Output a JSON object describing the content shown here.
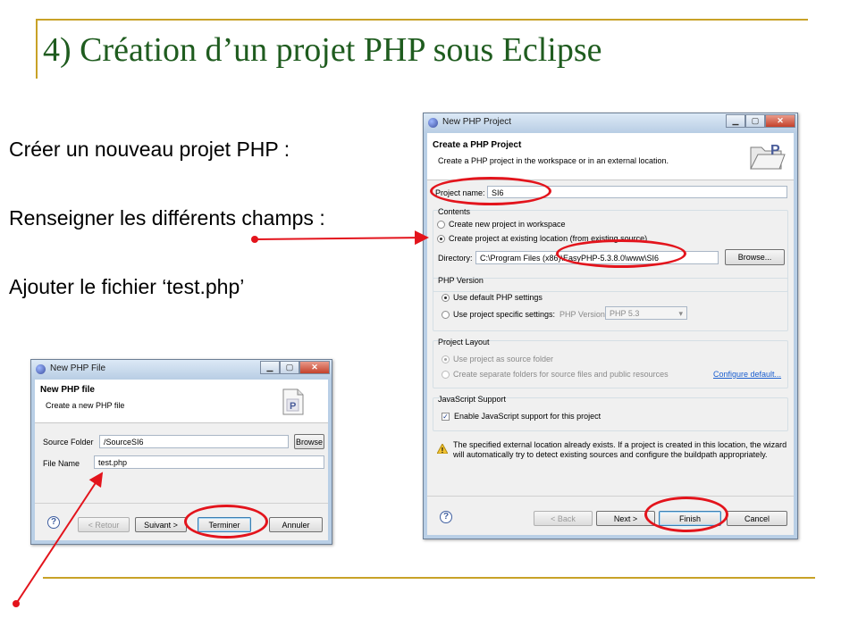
{
  "slide": {
    "title": "4) Création d’un projet PHP sous Eclipse",
    "bullets": [
      "Créer un nouveau projet PHP :",
      "Renseigner les différents champs :",
      "Ajouter le fichier ‘test.php’"
    ]
  },
  "colors": {
    "accent_rule": "#c8a227",
    "title": "#1f5c1f",
    "annotation": "#e3141c"
  },
  "php_file_dialog": {
    "window_title": "New PHP File",
    "header": "New PHP file",
    "description": "Create a new PHP file",
    "source_folder_label": "Source Folder",
    "source_folder_value": "/SourceSI6",
    "browse_label": "Browse",
    "file_name_label": "File Name",
    "file_name_value": "test.php",
    "back_label": "< Retour",
    "next_label": "Suivant >",
    "finish_label": "Terminer",
    "cancel_label": "Annuler",
    "icon": "php-file-icon"
  },
  "php_project_dialog": {
    "window_title": "New PHP Project",
    "header": "Create a PHP Project",
    "description": "Create a PHP project in the workspace or in an external location.",
    "project_name_label": "Project name:",
    "project_name_value": "SI6",
    "contents_label": "Contents",
    "opt_workspace": "Create new project in workspace",
    "opt_existing": "Create project at existing location (from existing source)",
    "directory_label": "Directory:",
    "directory_value": "C:\\Program Files (x86)\\EasyPHP-5.3.8.0\\www\\SI6",
    "browse_label": "Browse...",
    "php_version_label": "PHP Version",
    "opt_default_php": "Use default PHP settings",
    "opt_specific_php": "Use project specific settings:",
    "php_version_field_label": "PHP Version:",
    "php_version_value": "PHP 5.3",
    "layout_label": "Project Layout",
    "opt_source_folder": "Use project as source folder",
    "opt_separate_folders": "Create separate folders for source files and public resources",
    "configure_link": "Configure default...",
    "js_label": "JavaScript Support",
    "js_checkbox": "Enable JavaScript support for this project",
    "warning": "The specified external location already exists. If a project is created in this location, the wizard will automatically try to detect existing sources and configure the buildpath appropriately.",
    "back_label": "< Back",
    "next_label": "Next >",
    "finish_label": "Finish",
    "cancel_label": "Cancel",
    "icon": "php-folder-icon"
  }
}
